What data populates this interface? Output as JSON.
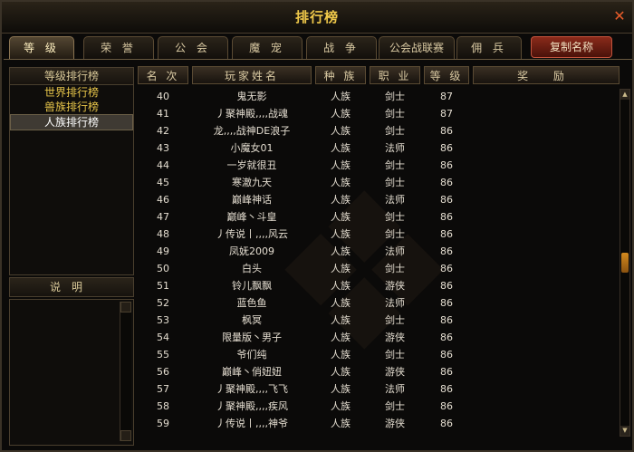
{
  "window": {
    "title": "排行榜",
    "close_icon": "close-icon"
  },
  "tabs": [
    {
      "label": "等 级",
      "active": true
    },
    {
      "label": "荣 誉",
      "active": false
    },
    {
      "label": "公 会",
      "active": false
    },
    {
      "label": "魔 宠",
      "active": false
    },
    {
      "label": "战 争",
      "active": false
    },
    {
      "label": "公会战联赛",
      "active": false
    },
    {
      "label": "佣 兵",
      "active": false
    }
  ],
  "copy_button": "复制名称",
  "left": {
    "header": "等级排行榜",
    "items": [
      "世界排行榜",
      "兽族排行榜",
      "人族排行榜"
    ],
    "selected_index": 2
  },
  "desc": {
    "header": "说明"
  },
  "table": {
    "columns": [
      "名 次",
      "玩家姓名",
      "种 族",
      "职 业",
      "等 级",
      "奖 励"
    ],
    "rows": [
      [
        "40",
        "鬼无影",
        "人族",
        "剑士",
        "87"
      ],
      [
        "41",
        "丿聚神殿,,,,战魂",
        "人族",
        "剑士",
        "87"
      ],
      [
        "42",
        "龙,,,,战神DE浪子",
        "人族",
        "剑士",
        "86"
      ],
      [
        "43",
        "小魔女01",
        "人族",
        "法师",
        "86"
      ],
      [
        "44",
        "一岁就很丑",
        "人族",
        "剑士",
        "86"
      ],
      [
        "45",
        "寒澈九天",
        "人族",
        "剑士",
        "86"
      ],
      [
        "46",
        "巅峰神话",
        "人族",
        "法师",
        "86"
      ],
      [
        "47",
        "巅峰丶斗皇",
        "人族",
        "剑士",
        "86"
      ],
      [
        "48",
        "丿传说丨,,,,风云",
        "人族",
        "剑士",
        "86"
      ],
      [
        "49",
        "凤妩2009",
        "人族",
        "法师",
        "86"
      ],
      [
        "50",
        "白头",
        "人族",
        "剑士",
        "86"
      ],
      [
        "51",
        "铃儿飘飘",
        "人族",
        "游侠",
        "86"
      ],
      [
        "52",
        "蓝色鱼",
        "人族",
        "法师",
        "86"
      ],
      [
        "53",
        "枫冥",
        "人族",
        "剑士",
        "86"
      ],
      [
        "54",
        "限量版丶男子",
        "人族",
        "游侠",
        "86"
      ],
      [
        "55",
        "爷们纯",
        "人族",
        "剑士",
        "86"
      ],
      [
        "56",
        "巅峰丶俏妞妞",
        "人族",
        "游侠",
        "86"
      ],
      [
        "57",
        "丿聚神殿,,,,飞飞",
        "人族",
        "法师",
        "86"
      ],
      [
        "58",
        "丿聚神殿,,,,疾风",
        "人族",
        "剑士",
        "86"
      ],
      [
        "59",
        "丿传说丨,,,,神爷",
        "人族",
        "游侠",
        "86"
      ]
    ]
  },
  "colors": {
    "accent": "#f0c94a",
    "list_gold": "#e8c64a",
    "copy_button": "#8a2a1a",
    "scroll_thumb": "#d48a1e"
  }
}
